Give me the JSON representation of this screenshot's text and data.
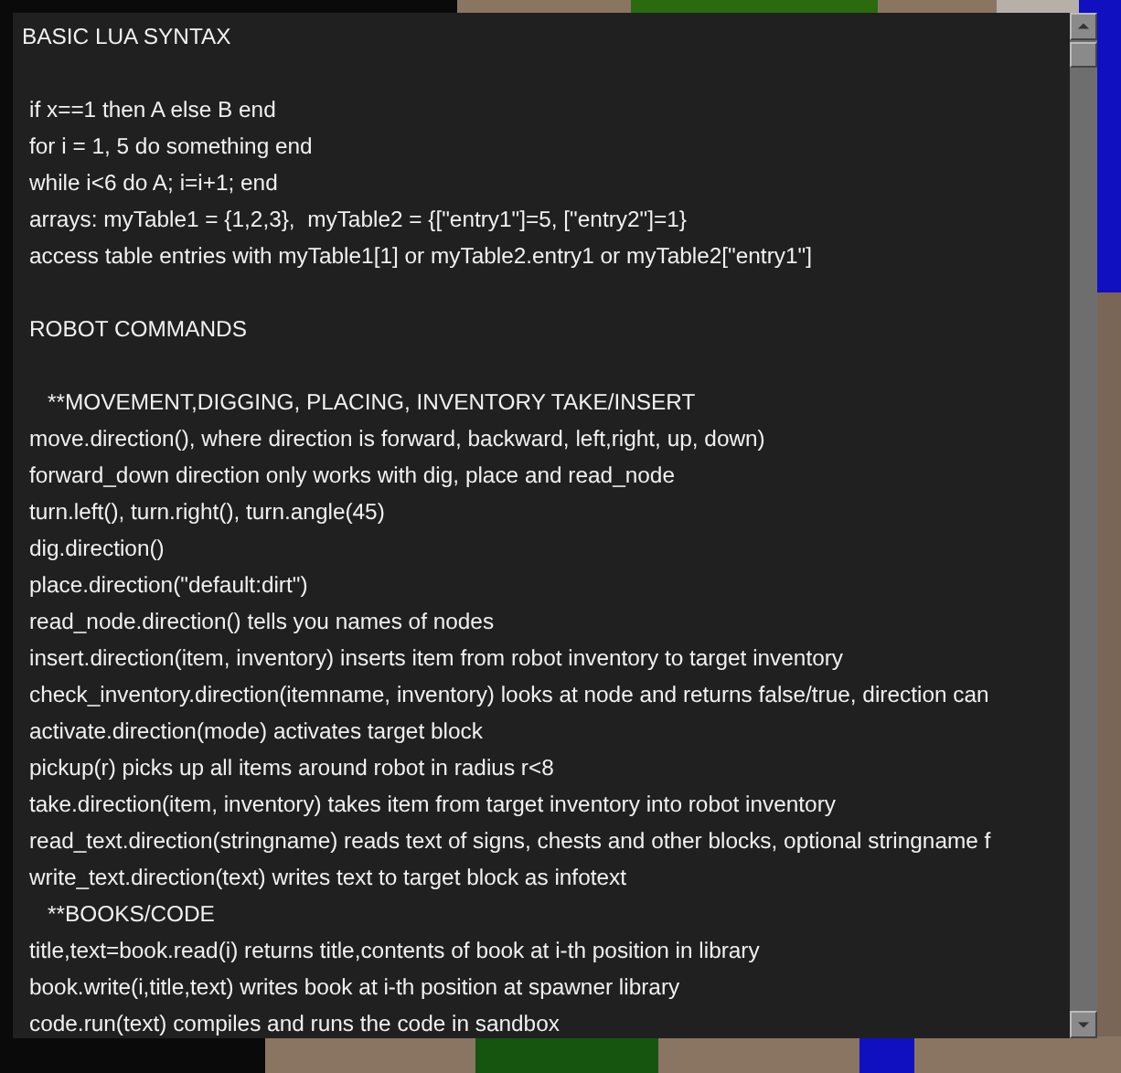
{
  "sections": [
    {
      "title": "BASIC LUA SYNTAX",
      "lines": [
        {
          "kind": "code",
          "text": "if x==1 then A else B end"
        },
        {
          "kind": "code",
          "text": "for i = 1, 5 do something end"
        },
        {
          "kind": "code",
          "text": "while i<6 do A; i=i+1; end"
        },
        {
          "kind": "code",
          "text": "arrays: myTable1 = {1,2,3},  myTable2 = {[\"entry1\"]=5, [\"entry2\"]=1}"
        },
        {
          "kind": "code",
          "text": "access table entries with myTable1[1] or myTable2.entry1 or myTable2[\"entry1\"]"
        }
      ]
    },
    {
      "title": "ROBOT COMMANDS",
      "lines": [
        {
          "kind": "subheading",
          "text": "**MOVEMENT,DIGGING, PLACING, INVENTORY TAKE/INSERT"
        },
        {
          "kind": "code",
          "text": "move.direction(), where direction is forward, backward, left,right, up, down)"
        },
        {
          "kind": "code",
          "text": "forward_down direction only works with dig, place and read_node"
        },
        {
          "kind": "code",
          "text": "turn.left(), turn.right(), turn.angle(45)"
        },
        {
          "kind": "code",
          "text": "dig.direction()"
        },
        {
          "kind": "code",
          "text": "place.direction(\"default:dirt\")"
        },
        {
          "kind": "code",
          "text": "read_node.direction() tells you names of nodes"
        },
        {
          "kind": "code",
          "text": "insert.direction(item, inventory) inserts item from robot inventory to target inventory"
        },
        {
          "kind": "code",
          "text": "check_inventory.direction(itemname, inventory) looks at node and returns false/true, direction can"
        },
        {
          "kind": "code",
          "text": "activate.direction(mode) activates target block"
        },
        {
          "kind": "code",
          "text": "pickup(r) picks up all items around robot in radius r<8"
        },
        {
          "kind": "code",
          "text": "take.direction(item, inventory) takes item from target inventory into robot inventory"
        },
        {
          "kind": "code",
          "text": "read_text.direction(stringname) reads text of signs, chests and other blocks, optional stringname f"
        },
        {
          "kind": "code",
          "text": "write_text.direction(text) writes text to target block as infotext"
        },
        {
          "kind": "subheading",
          "text": "**BOOKS/CODE"
        },
        {
          "kind": "code",
          "text": "title,text=book.read(i) returns title,contents of book at i-th position in library"
        },
        {
          "kind": "code",
          "text": "book.write(i,title,text) writes book at i-th position at spawner library"
        },
        {
          "kind": "code",
          "text": "code.run(text) compiles and runs the code in sandbox"
        }
      ]
    }
  ]
}
